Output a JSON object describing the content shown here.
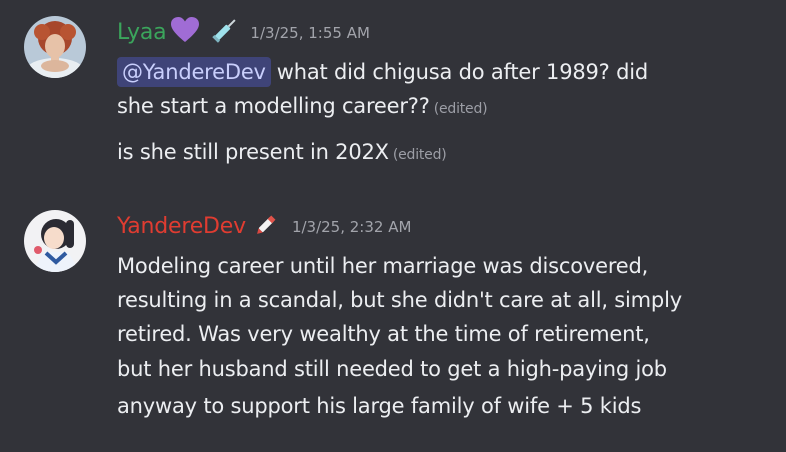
{
  "messages": [
    {
      "username": "Lyaa",
      "username_color": "#3ba55c",
      "badges": [
        "purple-heart-icon",
        "syringe-icon"
      ],
      "timestamp": "1/3/25, 1:55 AM",
      "mention": "@YandereDev",
      "lines": [
        "what did chigusa do after 1989? did",
        "she start a modelling career??",
        "is she still present in 202X"
      ],
      "edited_label": "(edited)"
    },
    {
      "username": "YandereDev",
      "username_color": "#e03c31",
      "badges": [
        "pen-icon"
      ],
      "timestamp": "1/3/25, 2:32 AM",
      "lines": [
        "Modeling career until her marriage was discovered,",
        "resulting in a scandal, but she didn't care at all, simply",
        "retired. Was very wealthy at the time of retirement,",
        "but her husband still needed to get a high-paying job",
        "anyway to support his large family of wife + 5 kids"
      ]
    }
  ]
}
